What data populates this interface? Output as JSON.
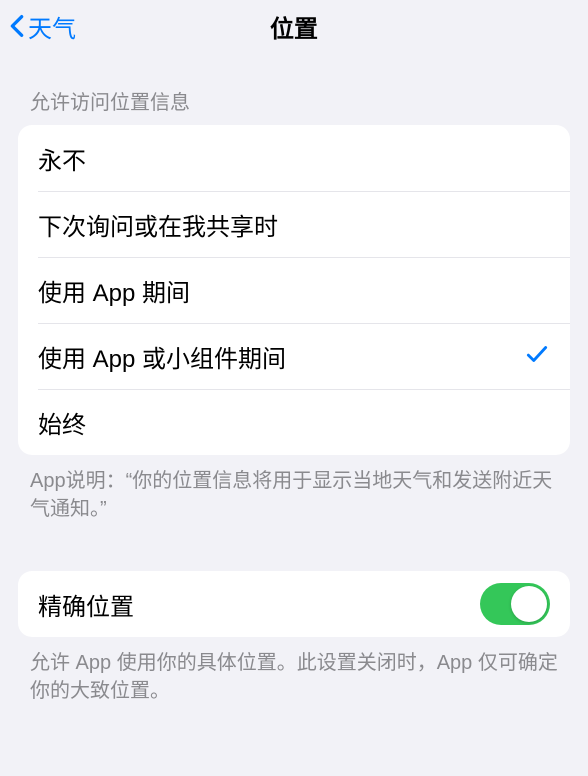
{
  "nav": {
    "back_label": "天气",
    "title": "位置"
  },
  "access_section": {
    "header": "允许访问位置信息",
    "options": [
      {
        "label": "永不",
        "selected": false
      },
      {
        "label": "下次询问或在我共享时",
        "selected": false
      },
      {
        "label": "使用 App 期间",
        "selected": false
      },
      {
        "label": "使用 App 或小组件期间",
        "selected": true
      },
      {
        "label": "始终",
        "selected": false
      }
    ],
    "footer": "App说明：“你的位置信息将用于显示当地天气和发送附近天气通知。”"
  },
  "precise_section": {
    "label": "精确位置",
    "enabled": true,
    "footer": "允许 App 使用你的具体位置。此设置关闭时，App 仅可确定你的大致位置。"
  }
}
